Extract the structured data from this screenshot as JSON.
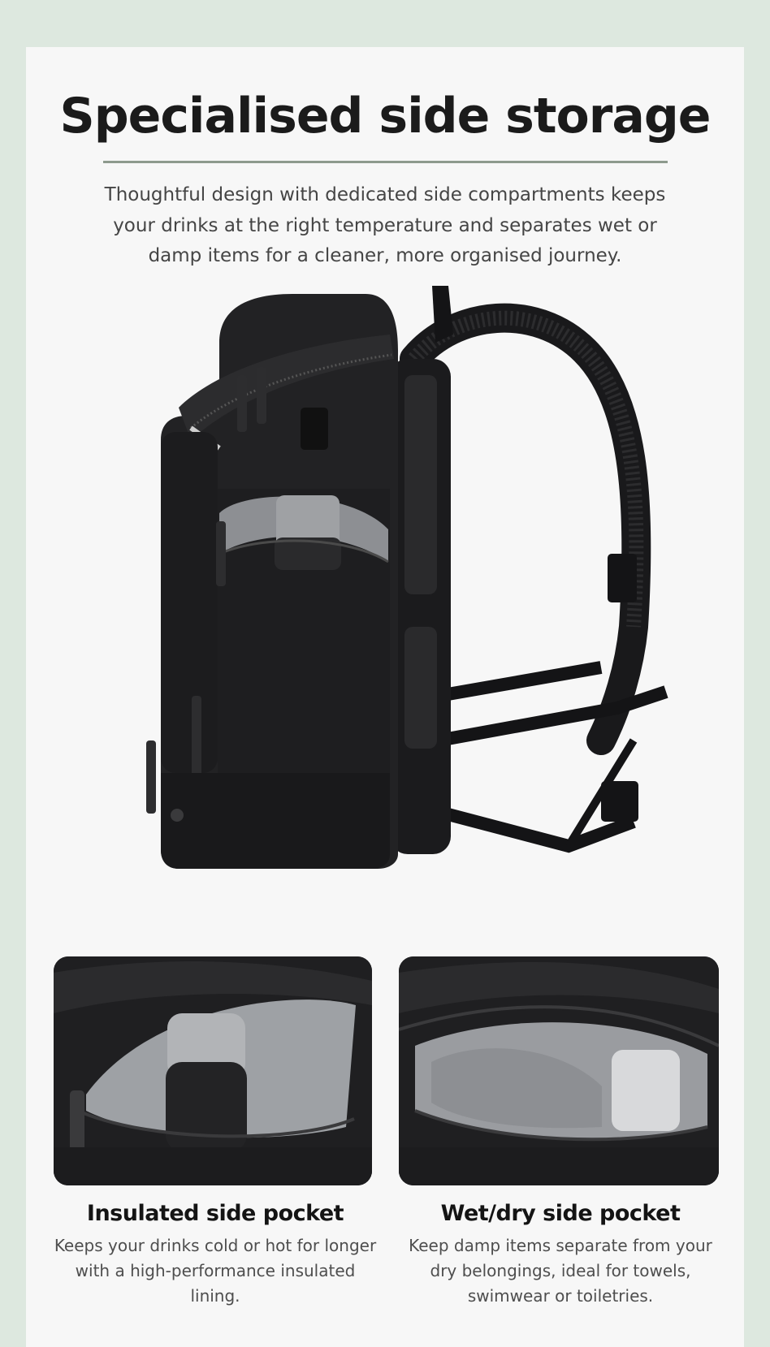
{
  "header": {
    "title": "Specialised side storage",
    "description": "Thoughtful design with dedicated side compartments keeps your drinks at the right temperature and separates wet or damp items for a cleaner, more organised journey."
  },
  "features": [
    {
      "title": "Insulated side pocket",
      "description": "Keeps your drinks cold or hot for longer with a high-performance insulated lining."
    },
    {
      "title": "Wet/dry side pocket",
      "description": "Keep damp items separate from your dry belongings, ideal for towels, swimwear or toiletries."
    }
  ],
  "colors": {
    "outer_background": "#dde8df",
    "card_background": "#f7f7f7",
    "accent_rule": "#8e9a8e",
    "product": "#1f1f21"
  },
  "images": [
    "backpack-side-view",
    "insulated-pocket-closeup",
    "wet-dry-pocket-closeup"
  ]
}
